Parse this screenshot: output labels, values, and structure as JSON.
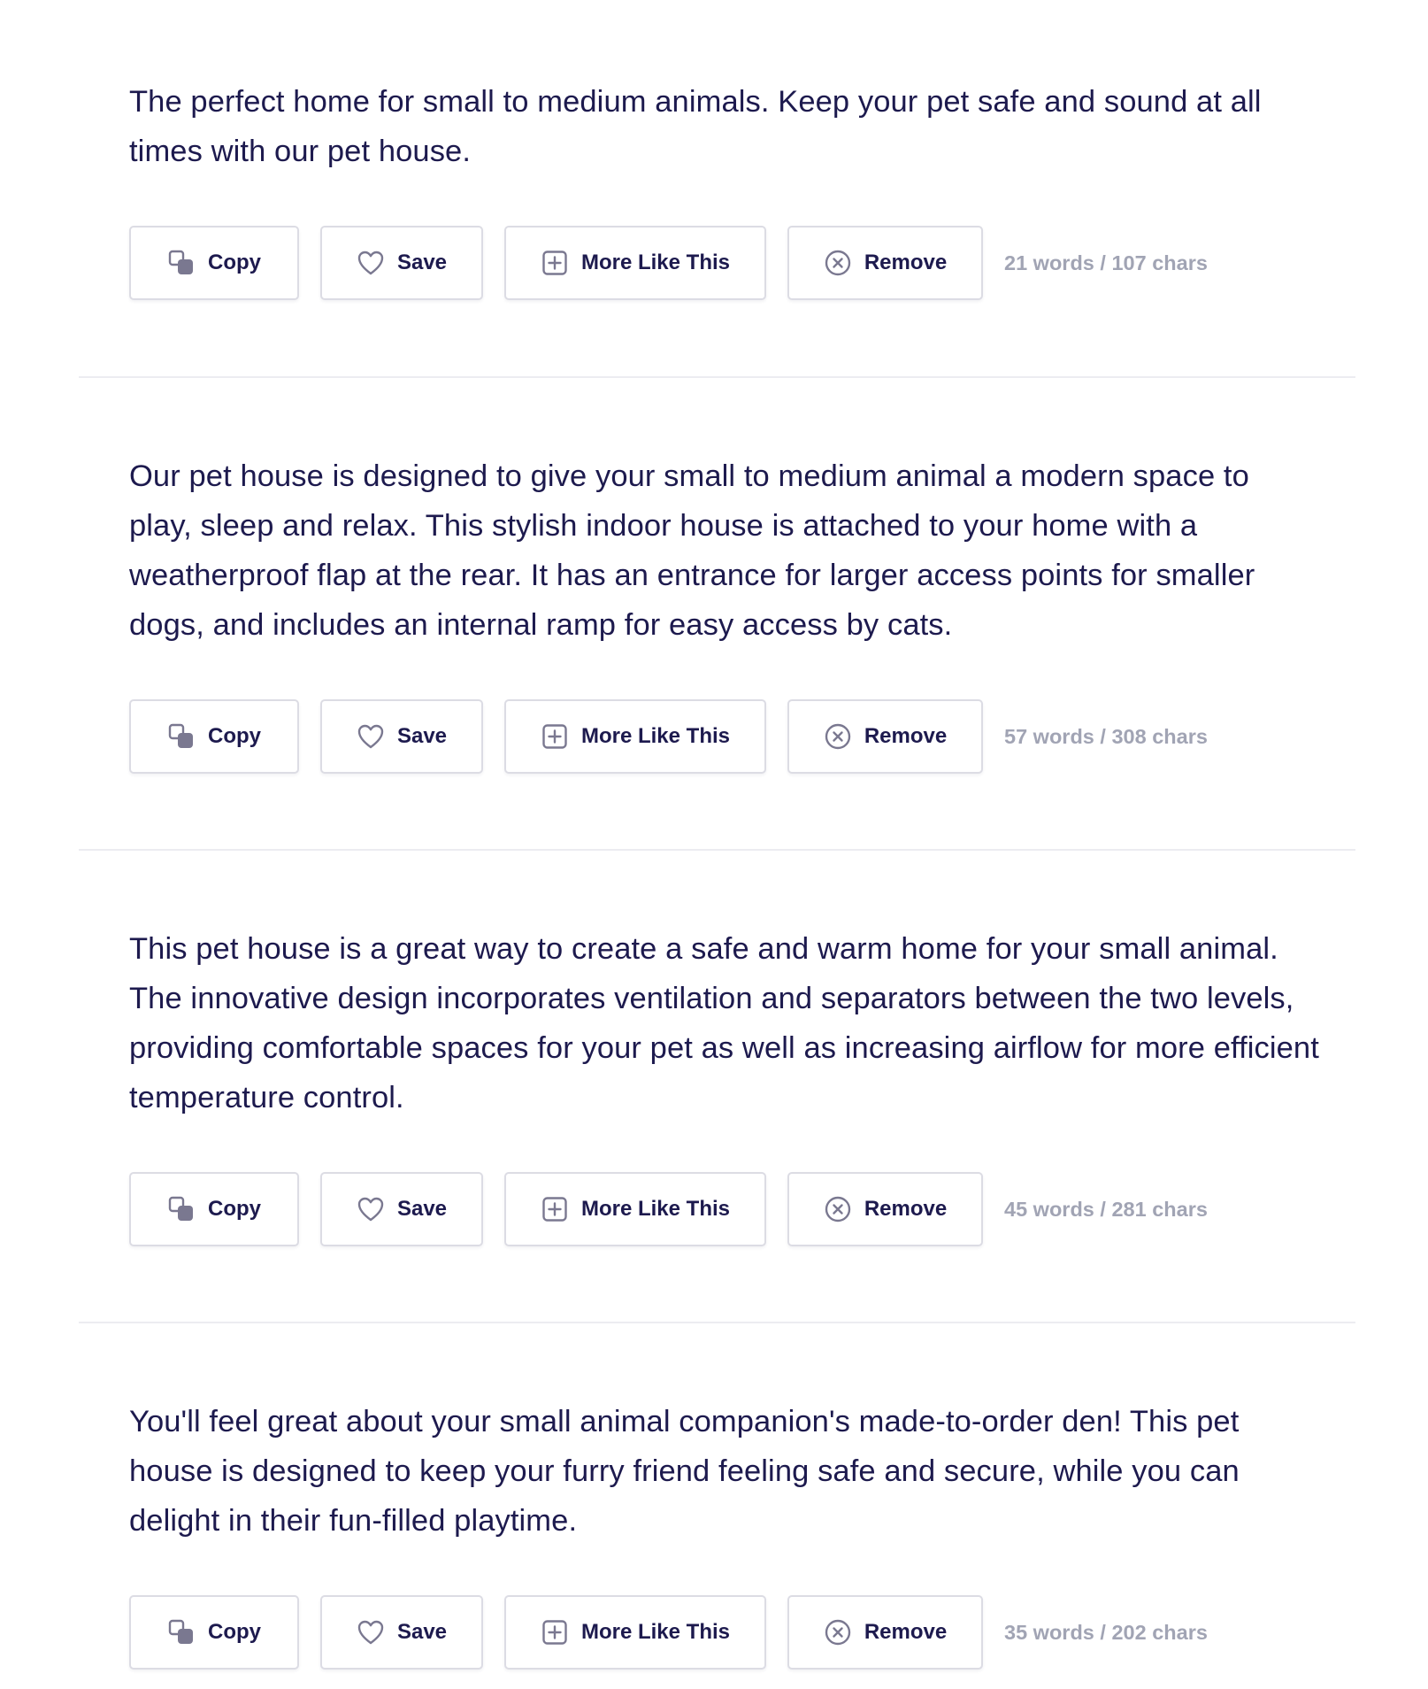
{
  "results": [
    {
      "text": "The perfect home for small to medium animals. Keep your pet safe and sound at all times with our pet house.",
      "stats": "21 words / 107 chars"
    },
    {
      "text": "Our pet house is designed to give your small to medium animal a modern space to play, sleep and relax. This stylish indoor house is attached to your home with a weatherproof flap at the rear. It has an entrance for larger access points for smaller dogs, and includes an internal ramp for easy access by cats.",
      "stats": "57 words / 308 chars"
    },
    {
      "text": "This pet house is a great way to create a safe and warm home for your small animal. The innovative design incorporates ventilation and separators between the two levels, providing comfortable spaces for your pet as well as increasing airflow for more efficient temperature control.",
      "stats": "45 words / 281 chars"
    },
    {
      "text": "You'll feel great about your small animal companion's made-to-order den! This pet house is designed to keep your furry friend feeling safe and secure, while you can delight in their fun-filled playtime.",
      "stats": "35 words / 202 chars"
    }
  ],
  "buttons": {
    "copy": "Copy",
    "save": "Save",
    "more": "More Like This",
    "remove": "Remove"
  },
  "icons": {
    "copy": "copy-icon",
    "save": "heart-icon",
    "more": "plus-square-icon",
    "remove": "x-circle-icon"
  },
  "colors": {
    "text": "#1d1a4e",
    "muted": "#a1a4b4",
    "icon": "#7a7890",
    "border": "#dcdce4",
    "divider": "#ececf1"
  }
}
